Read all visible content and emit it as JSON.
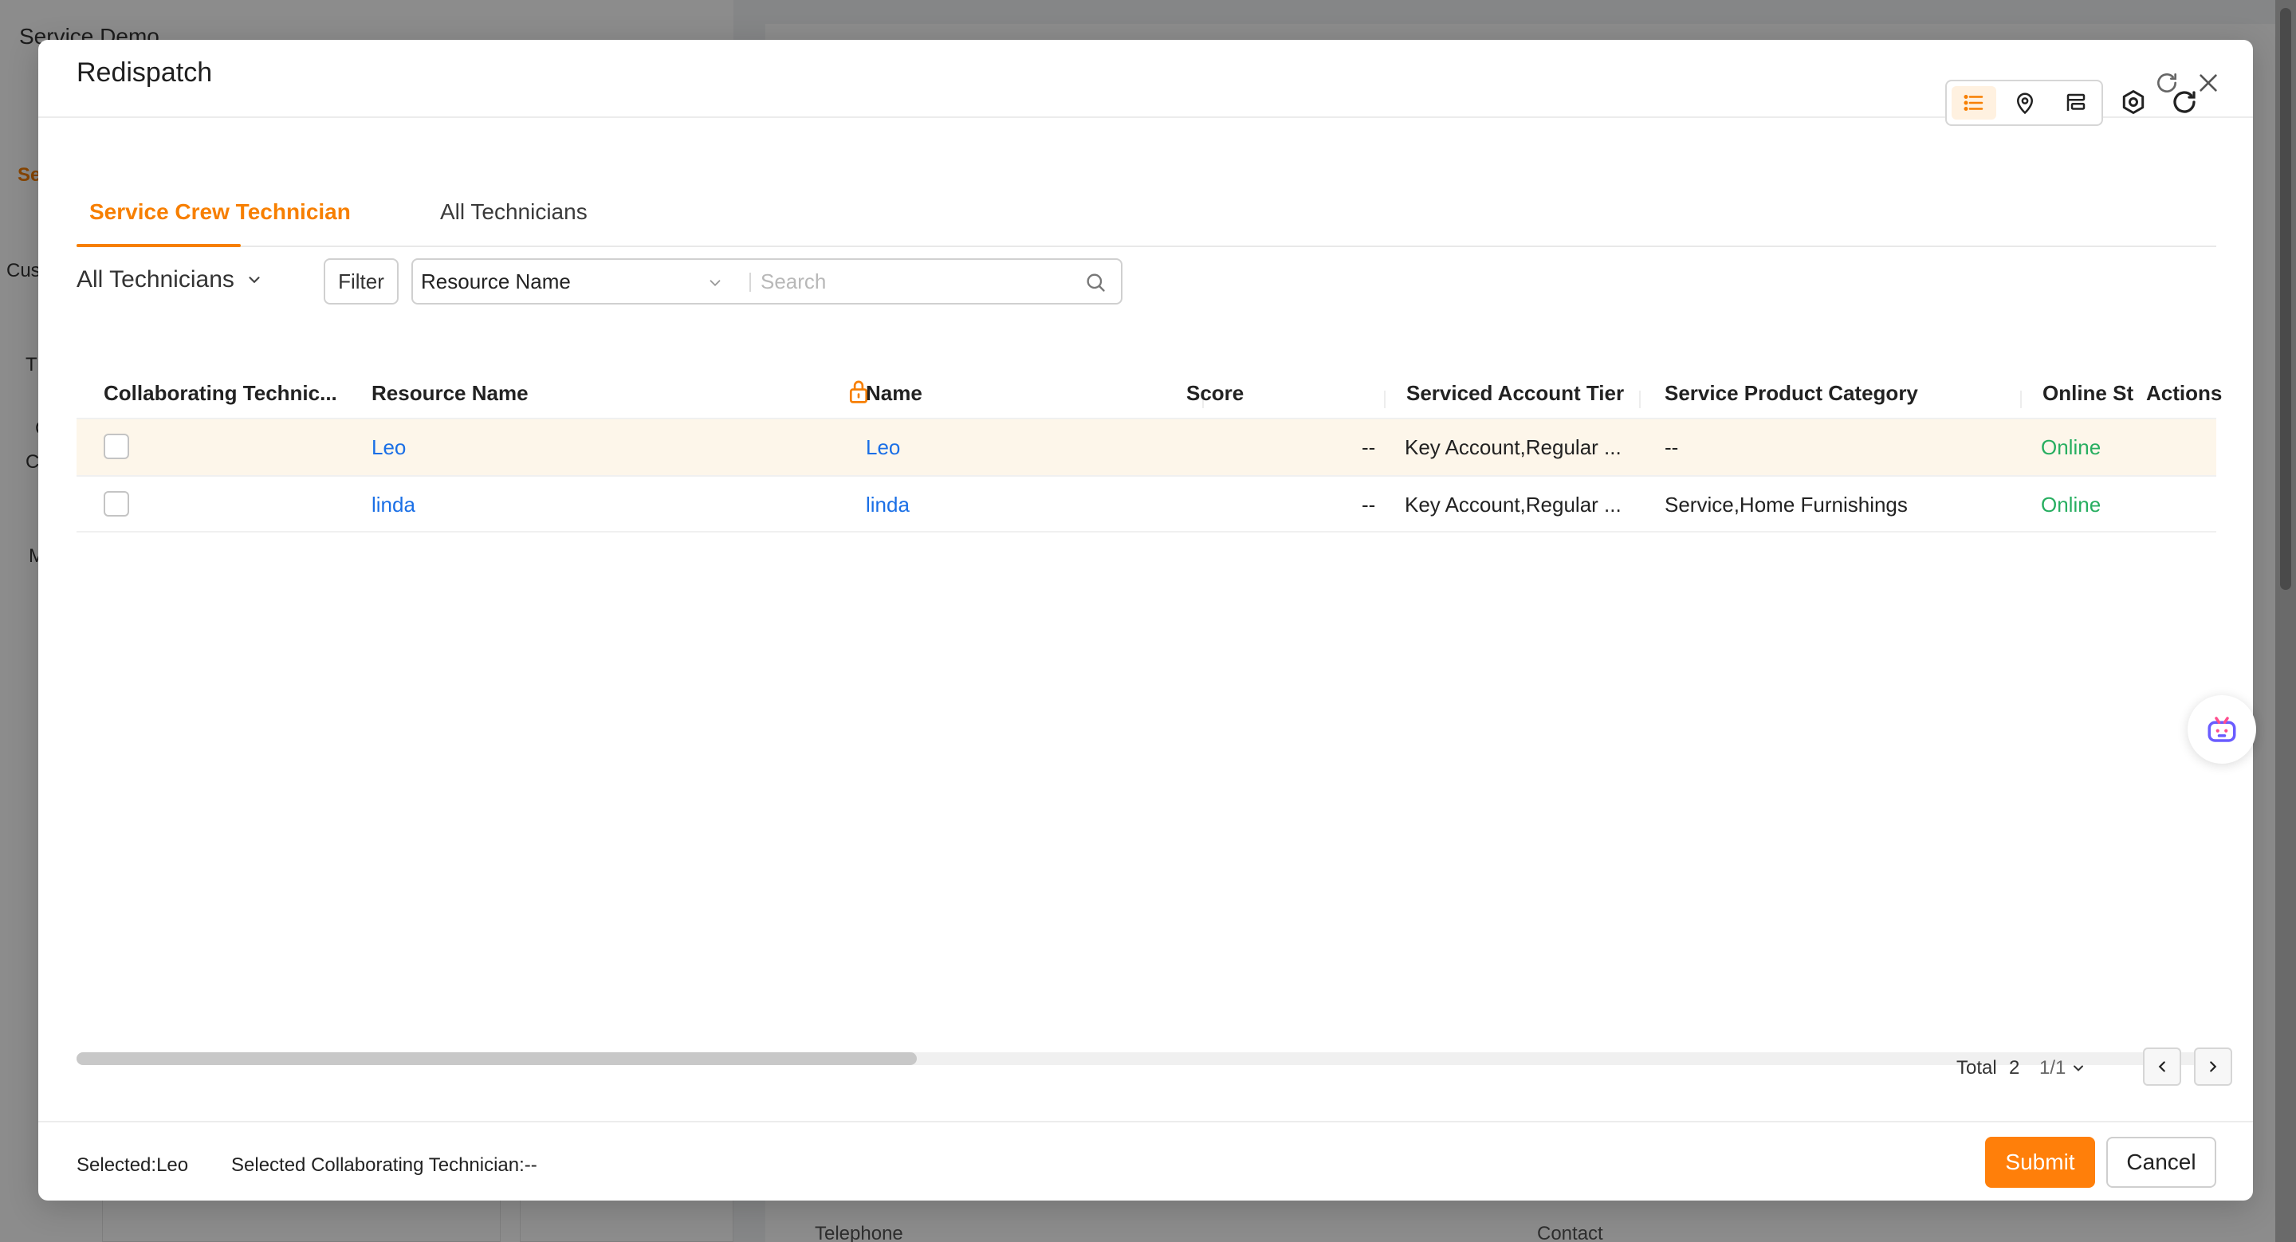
{
  "background": {
    "app_title": "Service Demo",
    "side_tab_label": "Se",
    "side_labels": [
      "Cus",
      "T",
      "C",
      "C",
      "M"
    ],
    "bottom_labels": [
      "Telephone",
      "Contact"
    ]
  },
  "modal": {
    "title": "Redispatch",
    "refresh_icon": "refresh-icon",
    "close_icon": "close-icon"
  },
  "tabs": [
    {
      "label": "Service Crew Technician",
      "active": true
    },
    {
      "label": "All Technicians",
      "active": false
    }
  ],
  "toolbar": {
    "view_label": "All Technicians",
    "filter_label": "Filter",
    "field_select_value": "Resource Name",
    "search_placeholder": "Search",
    "view_modes": [
      "list-icon",
      "map-pin-icon",
      "gantt-icon"
    ],
    "settings_icon": "settings-icon",
    "reload_icon": "reload-icon"
  },
  "table": {
    "columns": [
      "Collaborating Technic...",
      "Resource Name",
      "Name",
      "Score",
      "Serviced Account Tier",
      "Service Product Category",
      "Online St",
      "Actions"
    ],
    "rows": [
      {
        "resource_name": "Leo",
        "name": "Leo",
        "score": "--",
        "tier": "Key Account,Regular ...",
        "category": "--",
        "status": "Online",
        "highlight": true
      },
      {
        "resource_name": "linda",
        "name": "linda",
        "score": "--",
        "tier": "Key Account,Regular ...",
        "category": "Service,Home Furnishings",
        "status": "Online",
        "highlight": false
      }
    ]
  },
  "pagination": {
    "total_label": "Total",
    "total_count": "2",
    "page": "1/1"
  },
  "footer": {
    "selected": "Selected:Leo",
    "selected_collab": "Selected Collaborating Technician:--",
    "submit_label": "Submit",
    "cancel_label": "Cancel"
  },
  "colors": {
    "accent": "#ff7f0a",
    "link": "#1a6fe6",
    "online": "#27ae60",
    "row_highlight": "#fdf6ea"
  }
}
